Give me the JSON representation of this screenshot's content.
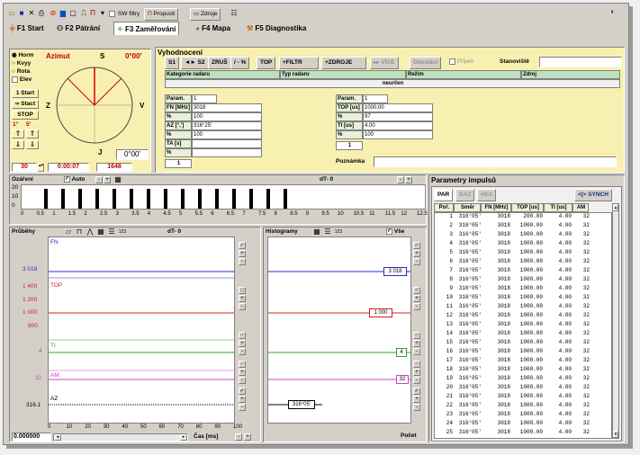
{
  "toolbar": {
    "sw_filter": "SW filtry",
    "propusti": "Propusti",
    "zdroje": "Zdroje"
  },
  "tabs": [
    {
      "label": "F1 Start"
    },
    {
      "label": "F2 Pátrání"
    },
    {
      "label": "F3 Zaměřování"
    },
    {
      "label": "F4 Mapa"
    },
    {
      "label": "F5 Diagnostika"
    }
  ],
  "compass": {
    "modes": [
      "Horm",
      "Kvyy",
      "Rota",
      "Elev"
    ],
    "azimut_label": "Azimut",
    "azimut_value": "0°00'",
    "north": "S",
    "south": "J",
    "east": "V",
    "west": "Z",
    "center_value": "0°00'",
    "start": "1 Start",
    "stact": "∞ Stact",
    "stop": "STOP",
    "step1": "1°",
    "step2": "5'",
    "count": "30",
    "time": "0:00:07",
    "num": "1648"
  },
  "vyh": {
    "title": "Vyhodnocení",
    "buttons": [
      "S1",
      "◄► S2",
      "ZRUŠ",
      "/ - %",
      "TOP",
      "+FILTR",
      "+ZDROJE",
      "▸▸ VÍCE",
      "Odeslání"
    ],
    "prijem": "Příjem",
    "stanoviste": "Stanoviště",
    "headers": [
      "Kategorie radaru",
      "Typ radaru",
      "Režim",
      "Zdroj"
    ],
    "neurceno": "neurčen",
    "left": {
      "param": "Param.",
      "param_v": "1",
      "rows": [
        [
          "FN [MHz]",
          "3018"
        ],
        [
          "%",
          "100"
        ],
        [
          "AZ [°,']",
          "316°25'"
        ],
        [
          "%",
          "100"
        ],
        [
          "TA [s]",
          ""
        ],
        [
          "%",
          ""
        ]
      ],
      "foot": "1"
    },
    "right": {
      "param": "Param.",
      "param_v": "1",
      "rows": [
        [
          "TOP [us]",
          "1000.00"
        ],
        [
          "%",
          "97"
        ],
        [
          "TI [us]",
          "4.00"
        ],
        [
          "%",
          "100"
        ]
      ],
      "foot": "1"
    },
    "poznamka": "Poznámka"
  },
  "ozareni": {
    "title": "Ozáření",
    "auto": "Auto",
    "dt": "dT- 0",
    "yticks": [
      "20",
      "10",
      "0"
    ],
    "xticks": [
      "0",
      "0.5",
      "1",
      "1.5",
      "2",
      "2.5",
      "3",
      "3.5",
      "4",
      "4.5",
      "5",
      "5.5",
      "6",
      "6.5",
      "7",
      "7.5",
      "8",
      "8.5",
      "9",
      "9.5",
      "10",
      "10.5",
      "11",
      "11.5",
      "12",
      "12.5"
    ]
  },
  "prubehy": {
    "title": "Průběhy",
    "dt": "dT- 0",
    "labels": [
      "FN",
      "TOP",
      "TI",
      "AM",
      "AZ"
    ],
    "yvals": [
      "3 018",
      "1 400",
      "1 200",
      "1 000",
      "800",
      "4",
      "32",
      "316.1"
    ],
    "xticks": [
      "0",
      "10",
      "20",
      "30",
      "40",
      "50",
      "60",
      "70",
      "80",
      "90",
      "100"
    ],
    "cas": "Čas [ms]",
    "bottom_value": "0.000000"
  },
  "histogram": {
    "title": "Histogramy",
    "vse": "Vše",
    "tags": [
      "3 018",
      "1 000",
      "4",
      "32",
      "316°05'"
    ],
    "pocet": "Počet"
  },
  "params": {
    "title": "Parametry impulsů",
    "tabs": [
      "PAR",
      "BAZ",
      "HEX"
    ],
    "synch": "<|> SYNCH",
    "cols": [
      "Poř.",
      "Směr",
      "FN [MHz]",
      "TOP [us]",
      "TI [us]",
      "AM"
    ],
    "rows": [
      [
        "1",
        "316°05'",
        "3018",
        "200.00",
        "4.00",
        "32"
      ],
      [
        "2",
        "316°05'",
        "3018",
        "1000.00",
        "4.00",
        "32"
      ],
      [
        "3",
        "316°05'",
        "3018",
        "1000.00",
        "4.00",
        "32"
      ],
      [
        "4",
        "316°05'",
        "3018",
        "1000.00",
        "4.00",
        "32"
      ],
      [
        "5",
        "316°05'",
        "3018",
        "1000.00",
        "4.00",
        "32"
      ],
      [
        "6",
        "316°05'",
        "3018",
        "1000.00",
        "4.00",
        "32"
      ],
      [
        "7",
        "316°05'",
        "3018",
        "1000.00",
        "4.00",
        "32"
      ],
      [
        "8",
        "316°05'",
        "3018",
        "1000.00",
        "4.00",
        "32"
      ],
      [
        "9",
        "316°05'",
        "3018",
        "1000.00",
        "4.00",
        "32"
      ],
      [
        "10",
        "316°05'",
        "3018",
        "1000.00",
        "4.00",
        "32"
      ],
      [
        "11",
        "316°05'",
        "3018",
        "1000.00",
        "4.00",
        "32"
      ],
      [
        "12",
        "316°05'",
        "3018",
        "1000.00",
        "4.00",
        "32"
      ],
      [
        "13",
        "316°05'",
        "3018",
        "1000.00",
        "4.00",
        "32"
      ],
      [
        "14",
        "316°05'",
        "3018",
        "1000.00",
        "4.00",
        "32"
      ],
      [
        "15",
        "316°05'",
        "3018",
        "1000.00",
        "4.00",
        "32"
      ],
      [
        "16",
        "316°05'",
        "3018",
        "1000.00",
        "4.00",
        "32"
      ],
      [
        "17",
        "316°05'",
        "3018",
        "1000.00",
        "4.00",
        "32"
      ],
      [
        "18",
        "316°05'",
        "3018",
        "1000.00",
        "4.00",
        "32"
      ],
      [
        "19",
        "316°05'",
        "3018",
        "1000.00",
        "4.00",
        "32"
      ],
      [
        "20",
        "316°05'",
        "3018",
        "1000.00",
        "4.00",
        "32"
      ],
      [
        "21",
        "316°05'",
        "3018",
        "1000.00",
        "4.00",
        "32"
      ],
      [
        "22",
        "316°05'",
        "3018",
        "1000.00",
        "4.00",
        "32"
      ],
      [
        "23",
        "316°05'",
        "3018",
        "1000.00",
        "4.00",
        "32"
      ],
      [
        "24",
        "316°05'",
        "3018",
        "1000.00",
        "4.00",
        "32"
      ],
      [
        "25",
        "316°05'",
        "3018",
        "1000.00",
        "4.00",
        "32"
      ]
    ]
  }
}
